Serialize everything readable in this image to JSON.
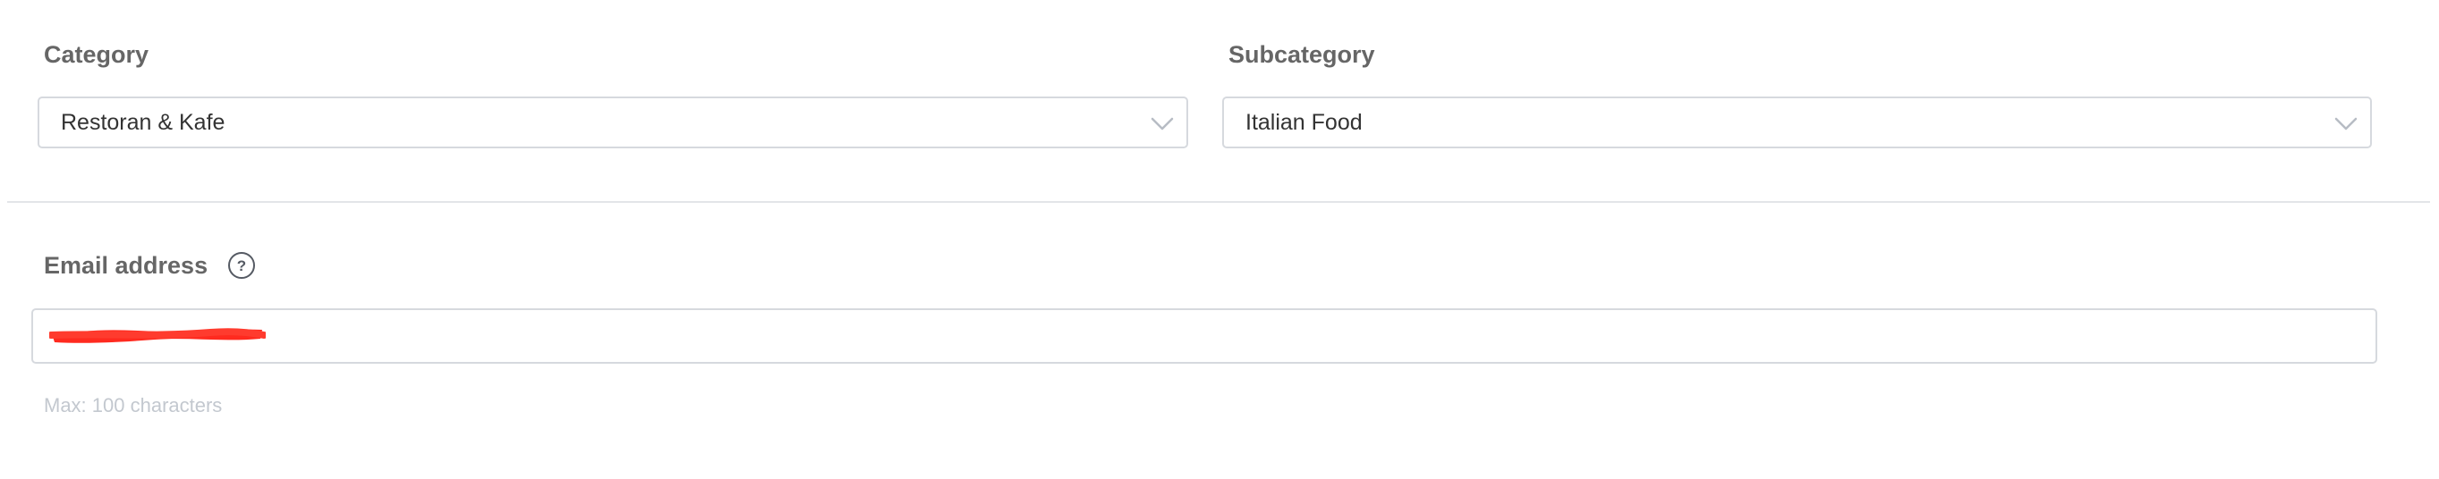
{
  "category": {
    "label": "Category",
    "selected": "Restoran & Kafe"
  },
  "subcategory": {
    "label": "Subcategory",
    "selected": "Italian Food"
  },
  "email": {
    "label": "Email address",
    "help_icon": "question-circle-icon",
    "value_redacted": true,
    "hint": "Max: 100 characters"
  },
  "colors": {
    "label_text": "#666666",
    "border": "#d6d9de",
    "hint_text": "#c3c8cf",
    "redaction": "#ff2a1f"
  }
}
